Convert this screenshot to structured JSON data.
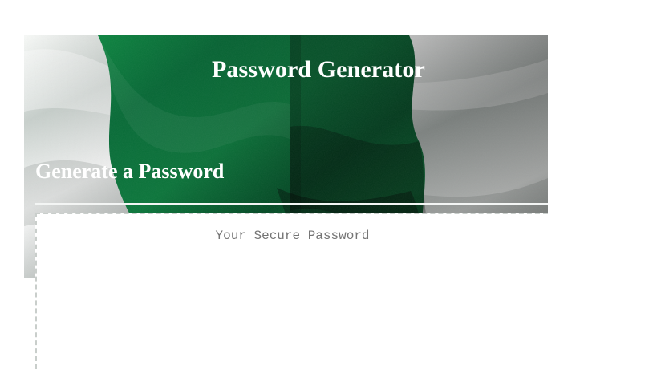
{
  "header": {
    "title": "Password Generator"
  },
  "generator": {
    "heading": "Generate a Password",
    "password_placeholder": "Your Secure Password",
    "password_value": ""
  },
  "colors": {
    "flag_green": "#0d7c3d",
    "flag_dark_green": "#06592d",
    "flag_white": "#f5f6f4",
    "text_white": "#ffffff",
    "placeholder_gray": "#747474"
  },
  "icons": {
    "background": "nigeria-flag-image"
  }
}
